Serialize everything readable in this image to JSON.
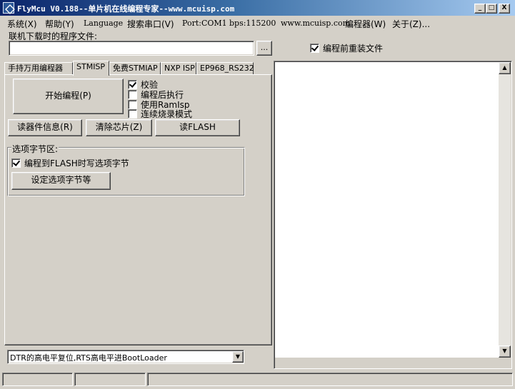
{
  "window": {
    "title": "FlyMcu V0.188--单片机在线编程专家--www.mcuisp.com",
    "controls": {
      "minimize": "_",
      "maximize": "□",
      "close": "X"
    }
  },
  "menu": {
    "items": [
      {
        "label": "系统(X)"
      },
      {
        "label": "帮助(Y)"
      },
      {
        "label": "Language"
      },
      {
        "label": "搜索串口(V)"
      },
      {
        "label": "Port:COM1"
      },
      {
        "label": "bps:115200"
      },
      {
        "label": "www.mcuisp.com"
      },
      {
        "label": "编程器(W)"
      },
      {
        "label": "关于(Z)..."
      }
    ]
  },
  "file": {
    "label": "联机下载时的程序文件:",
    "value": "",
    "browse_label": "...",
    "reload_label": "编程前重装文件",
    "reload_checked": true
  },
  "tabs": [
    {
      "label": "手持万用编程器",
      "active": false
    },
    {
      "label": "STMISP",
      "active": true
    },
    {
      "label": "免费STMIAP",
      "active": false
    },
    {
      "label": "NXP ISP",
      "active": false
    },
    {
      "label": "EP968_RS232",
      "active": false
    }
  ],
  "stmisp": {
    "start_label": "开始编程(P)",
    "options": [
      {
        "label": "校验",
        "checked": true
      },
      {
        "label": "编程后执行",
        "checked": false
      },
      {
        "label": "使用RamIsp",
        "checked": false
      },
      {
        "label": "连续烧录模式",
        "checked": false
      }
    ],
    "read_info_label": "读器件信息(R)",
    "erase_label": "清除芯片(Z)",
    "read_flash_label": "读FLASH",
    "option_group": {
      "legend": "选项字节区:",
      "write_option_label": "编程到FLASH时写选项字节",
      "write_option_checked": true,
      "set_label": "设定选项字节等"
    }
  },
  "reset_mode": {
    "selected": "DTR的高电平复位,RTS高电平进BootLoader"
  },
  "log": {
    "text": ""
  },
  "statusbar": {
    "cells": [
      "",
      "",
      ""
    ]
  }
}
